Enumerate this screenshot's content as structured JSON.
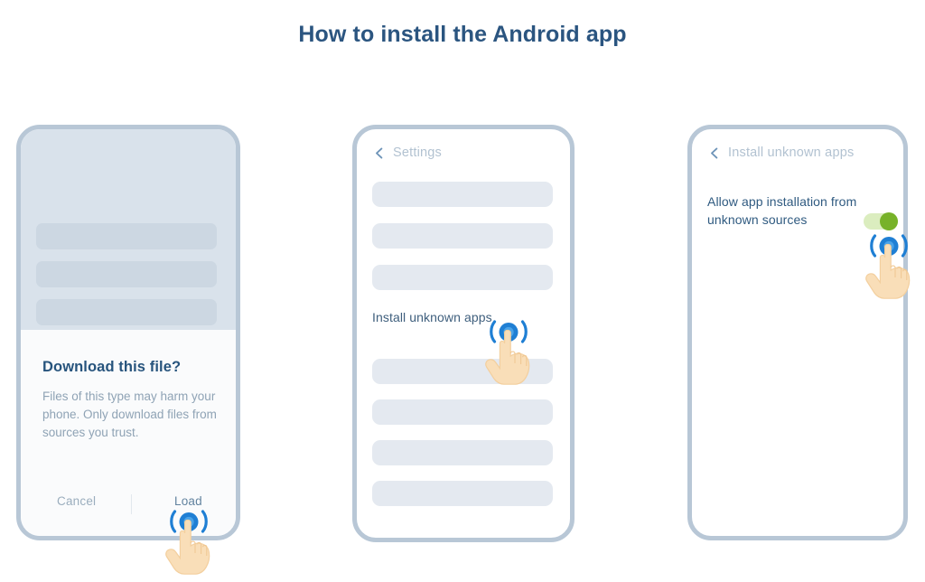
{
  "page": {
    "title": "How to install the Android app",
    "title_color": "#2b5580",
    "background": "#ffffff"
  },
  "steps": [
    {
      "id": "step-1-download",
      "dialog": {
        "heading": "Download this file?",
        "body": "Files of this type may harm your phone. Only download files from sources you trust.",
        "cancel_label": "Cancel",
        "confirm_label": "Load"
      },
      "tap_target": "Load"
    },
    {
      "id": "step-2-settings",
      "header": {
        "back_icon": "chevron-left-icon",
        "title": "Settings"
      },
      "list_item_label": "Install unknown apps",
      "tap_target": "Install unknown apps"
    },
    {
      "id": "step-3-allow",
      "header": {
        "back_icon": "chevron-left-icon",
        "title": "Install unknown apps"
      },
      "setting_label": "Allow app installation from unknown sources",
      "toggle": {
        "state": "on",
        "track_color": "#dbedbf",
        "knob_color": "#77b229"
      },
      "tap_target": "Allow app installation from unknown sources toggle"
    }
  ],
  "colors": {
    "phone_frame": "#b8c7d6",
    "placeholder_bar": "#e4e9f0",
    "page_bar": "#ccd7e2",
    "accent_blue": "#1f7fd4",
    "hand": "#f7d9b0"
  }
}
